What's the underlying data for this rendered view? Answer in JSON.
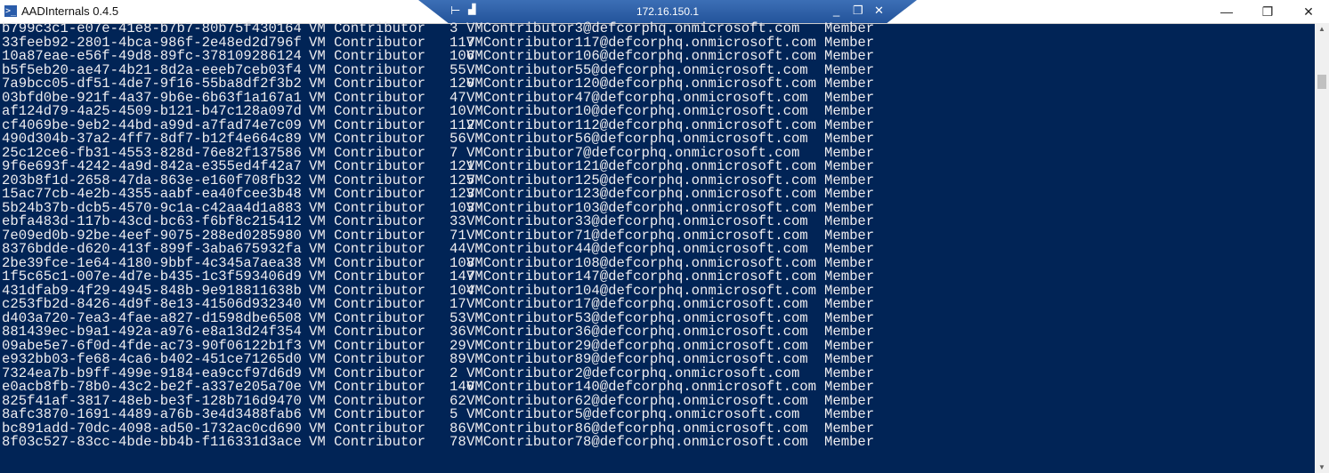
{
  "window": {
    "title": "AADInternals 0.4.5",
    "minimize": "—",
    "maximize": "❐",
    "close": "✕"
  },
  "rdp_bar": {
    "host": "172.16.150.1",
    "pin": "⊢",
    "signal": "▟",
    "minimize": "_",
    "restore": "❐",
    "close": "✕"
  },
  "rows": [
    {
      "id": "b799c3c1-e07e-41e8-b7b7-80b75f430164",
      "name": "VM Contributor",
      "num": "3",
      "upn": "VMContributor3@defcorphq.onmicrosoft.com",
      "type": "Member"
    },
    {
      "id": "33feeb92-2801-4bca-986f-2e48ed2d796f",
      "name": "VM Contributor",
      "num": "117",
      "upn": "VMContributor117@defcorphq.onmicrosoft.com",
      "type": "Member"
    },
    {
      "id": "10a87eae-e56f-49d8-89fc-378109286124",
      "name": "VM Contributor",
      "num": "106",
      "upn": "VMContributor106@defcorphq.onmicrosoft.com",
      "type": "Member"
    },
    {
      "id": "b5f5eb20-ae47-4b21-8d2a-eeeb7ceb03f4",
      "name": "VM Contributor",
      "num": "55",
      "upn": "VMContributor55@defcorphq.onmicrosoft.com",
      "type": "Member"
    },
    {
      "id": "7a9bcc05-df51-4de7-9f16-55ba8df2f3b2",
      "name": "VM Contributor",
      "num": "120",
      "upn": "VMContributor120@defcorphq.onmicrosoft.com",
      "type": "Member"
    },
    {
      "id": "03bfd0be-921f-4a37-9b6e-6b63f1a167a1",
      "name": "VM Contributor",
      "num": "47",
      "upn": "VMContributor47@defcorphq.onmicrosoft.com",
      "type": "Member"
    },
    {
      "id": "af124d79-4a25-4509-b121-b47c128a097d",
      "name": "VM Contributor",
      "num": "10",
      "upn": "VMContributor10@defcorphq.onmicrosoft.com",
      "type": "Member"
    },
    {
      "id": "cf4069be-9eb2-44bd-a99d-a7fad74e7c09",
      "name": "VM Contributor",
      "num": "112",
      "upn": "VMContributor112@defcorphq.onmicrosoft.com",
      "type": "Member"
    },
    {
      "id": "490d304b-37a2-4ff7-8df7-b12f4e664c89",
      "name": "VM Contributor",
      "num": "56",
      "upn": "VMContributor56@defcorphq.onmicrosoft.com",
      "type": "Member"
    },
    {
      "id": "25c12ce6-fb31-4553-828d-76e82f137586",
      "name": "VM Contributor",
      "num": "7",
      "upn": "VMContributor7@defcorphq.onmicrosoft.com",
      "type": "Member"
    },
    {
      "id": "9f6e693f-4242-4a9d-842a-e355ed4f42a7",
      "name": "VM Contributor",
      "num": "121",
      "upn": "VMContributor121@defcorphq.onmicrosoft.com",
      "type": "Member"
    },
    {
      "id": "203b8f1d-2658-47da-863e-e160f708fb32",
      "name": "VM Contributor",
      "num": "125",
      "upn": "VMContributor125@defcorphq.onmicrosoft.com",
      "type": "Member"
    },
    {
      "id": "15ac77cb-4e2b-4355-aabf-ea40fcee3b48",
      "name": "VM Contributor",
      "num": "123",
      "upn": "VMContributor123@defcorphq.onmicrosoft.com",
      "type": "Member"
    },
    {
      "id": "5b24b37b-dcb5-4570-9c1a-c42aa4d1a883",
      "name": "VM Contributor",
      "num": "103",
      "upn": "VMContributor103@defcorphq.onmicrosoft.com",
      "type": "Member"
    },
    {
      "id": "ebfa483d-117b-43cd-bc63-f6bf8c215412",
      "name": "VM Contributor",
      "num": "33",
      "upn": "VMContributor33@defcorphq.onmicrosoft.com",
      "type": "Member"
    },
    {
      "id": "7e09ed0b-92be-4eef-9075-288ed0285980",
      "name": "VM Contributor",
      "num": "71",
      "upn": "VMContributor71@defcorphq.onmicrosoft.com",
      "type": "Member"
    },
    {
      "id": "8376bdde-d620-413f-899f-3aba675932fa",
      "name": "VM Contributor",
      "num": "44",
      "upn": "VMContributor44@defcorphq.onmicrosoft.com",
      "type": "Member"
    },
    {
      "id": "2be39fce-1e64-4180-9bbf-4c345a7aea38",
      "name": "VM Contributor",
      "num": "108",
      "upn": "VMContributor108@defcorphq.onmicrosoft.com",
      "type": "Member"
    },
    {
      "id": "1f5c65c1-007e-4d7e-b435-1c3f593406d9",
      "name": "VM Contributor",
      "num": "147",
      "upn": "VMContributor147@defcorphq.onmicrosoft.com",
      "type": "Member"
    },
    {
      "id": "431dfab9-4f29-4945-848b-9e918811638b",
      "name": "VM Contributor",
      "num": "104",
      "upn": "VMContributor104@defcorphq.onmicrosoft.com",
      "type": "Member"
    },
    {
      "id": "c253fb2d-8426-4d9f-8e13-41506d932340",
      "name": "VM Contributor",
      "num": "17",
      "upn": "VMContributor17@defcorphq.onmicrosoft.com",
      "type": "Member"
    },
    {
      "id": "d403a720-7ea3-4fae-a827-d1598dbe6508",
      "name": "VM Contributor",
      "num": "53",
      "upn": "VMContributor53@defcorphq.onmicrosoft.com",
      "type": "Member"
    },
    {
      "id": "881439ec-b9a1-492a-a976-e8a13d24f354",
      "name": "VM Contributor",
      "num": "36",
      "upn": "VMContributor36@defcorphq.onmicrosoft.com",
      "type": "Member"
    },
    {
      "id": "09abe5e7-6f0d-4fde-ac73-90f06122b1f3",
      "name": "VM Contributor",
      "num": "29",
      "upn": "VMContributor29@defcorphq.onmicrosoft.com",
      "type": "Member"
    },
    {
      "id": "e932bb03-fe68-4ca6-b402-451ce71265d0",
      "name": "VM Contributor",
      "num": "89",
      "upn": "VMContributor89@defcorphq.onmicrosoft.com",
      "type": "Member"
    },
    {
      "id": "7324ea7b-b9ff-499e-9184-ea9ccf97d6d9",
      "name": "VM Contributor",
      "num": "2",
      "upn": "VMContributor2@defcorphq.onmicrosoft.com",
      "type": "Member"
    },
    {
      "id": "e0acb8fb-78b0-43c2-be2f-a337e205a70e",
      "name": "VM Contributor",
      "num": "140",
      "upn": "VMContributor140@defcorphq.onmicrosoft.com",
      "type": "Member"
    },
    {
      "id": "825f41af-3817-48eb-be3f-128b716d9470",
      "name": "VM Contributor",
      "num": "62",
      "upn": "VMContributor62@defcorphq.onmicrosoft.com",
      "type": "Member"
    },
    {
      "id": "8afc3870-1691-4489-a76b-3e4d3488fab6",
      "name": "VM Contributor",
      "num": "5",
      "upn": "VMContributor5@defcorphq.onmicrosoft.com",
      "type": "Member"
    },
    {
      "id": "bc891add-70dc-4098-ad50-1732ac0cd690",
      "name": "VM Contributor",
      "num": "86",
      "upn": "VMContributor86@defcorphq.onmicrosoft.com",
      "type": "Member"
    },
    {
      "id": "8f03c527-83cc-4bde-bb4b-f116331d3ace",
      "name": "VM Contributor",
      "num": "78",
      "upn": "VMContributor78@defcorphq.onmicrosoft.com",
      "type": "Member"
    }
  ],
  "colors": {
    "console_bg": "#012456",
    "console_fg": "#eeedf0"
  }
}
